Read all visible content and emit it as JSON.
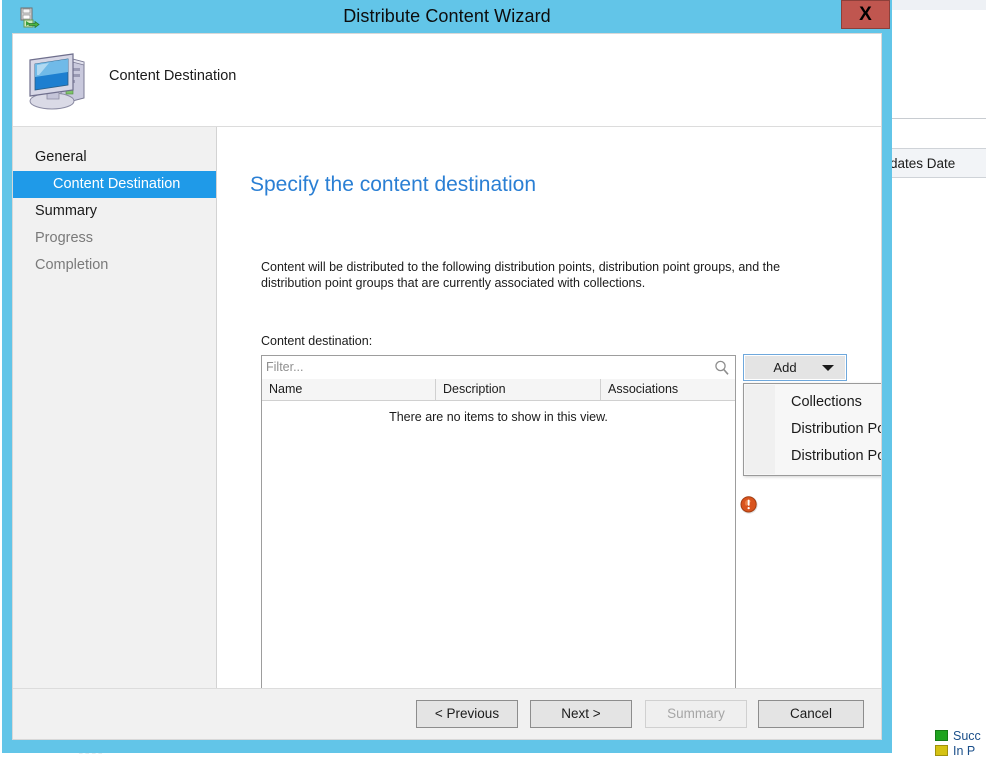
{
  "window": {
    "title": "Distribute Content Wizard",
    "title_icon": "distribute-content-icon",
    "close_label": "X",
    "titlebar_color": "#62c5e8",
    "close_color": "#c0564f"
  },
  "header": {
    "title": "Content Destination",
    "icon": "computer-icon"
  },
  "sidebar": {
    "items": [
      {
        "label": "General",
        "state": "visited",
        "indent": 0
      },
      {
        "label": "Content Destination",
        "state": "selected",
        "indent": 1
      },
      {
        "label": "Summary",
        "state": "visited",
        "indent": 0
      },
      {
        "label": "Progress",
        "state": "disabled",
        "indent": 0
      },
      {
        "label": "Completion",
        "state": "disabled",
        "indent": 0
      }
    ],
    "selected_color": "#1f9ae8"
  },
  "content": {
    "heading": "Specify the content destination",
    "heading_color": "#2a7fd4",
    "description": "Content will be distributed to the following distribution points, distribution point groups, and the distribution point groups that are currently associated with collections.",
    "destination_label": "Content destination:",
    "filter": {
      "placeholder": "Filter...",
      "value": "",
      "icon": "search-icon"
    },
    "list": {
      "columns": [
        "Name",
        "Description",
        "Associations"
      ],
      "rows": [],
      "empty_message": "There are no items to show in this view."
    },
    "validation_icon": "error-exclamation-icon",
    "validation_icon_color": "#d9541e"
  },
  "add_control": {
    "label": "Add",
    "caret_icon": "chevron-down-icon",
    "expanded": true,
    "menu_items": [
      "Collections",
      "Distribution Point",
      "Distribution Point Group"
    ]
  },
  "footer": {
    "previous": "< Previous",
    "next": "Next >",
    "summary": "Summary",
    "cancel": "Cancel",
    "summary_disabled": true
  },
  "background": {
    "column_header": "dates Date",
    "legend": [
      {
        "label": "Succ",
        "color": "#1fa31f"
      },
      {
        "label": "In P",
        "color": "#d5c213"
      }
    ]
  }
}
